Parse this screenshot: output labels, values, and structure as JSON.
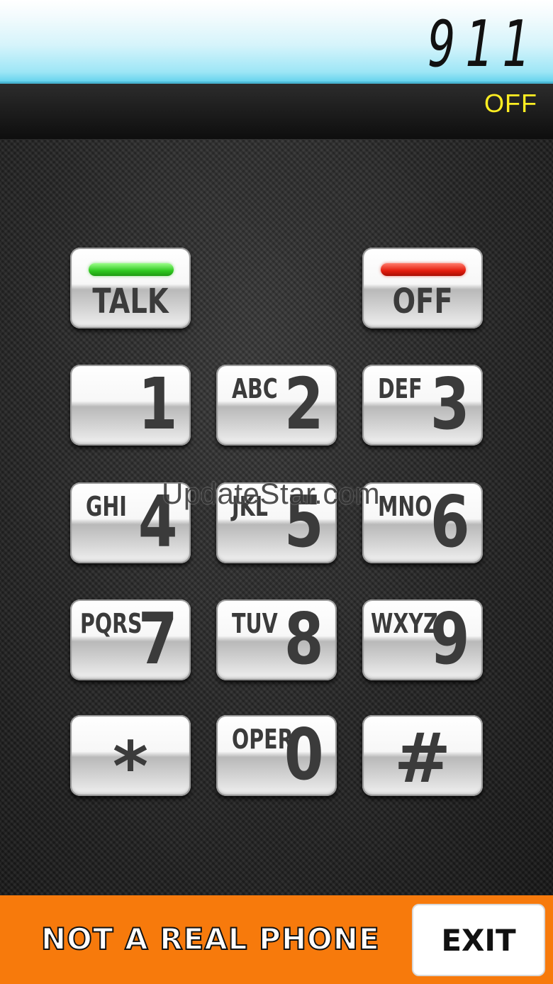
{
  "display": {
    "number": "911",
    "status": "OFF"
  },
  "keypad": {
    "talk": {
      "label": "TALK",
      "led_color": "#2fc81f"
    },
    "off": {
      "label": "OFF",
      "led_color": "#e31b0c"
    },
    "keys": [
      {
        "digit": "1",
        "letters": ""
      },
      {
        "digit": "2",
        "letters": "ABC"
      },
      {
        "digit": "3",
        "letters": "DEF"
      },
      {
        "digit": "4",
        "letters": "GHI"
      },
      {
        "digit": "5",
        "letters": "JKL"
      },
      {
        "digit": "6",
        "letters": "MNO"
      },
      {
        "digit": "7",
        "letters": "PQRS"
      },
      {
        "digit": "8",
        "letters": "TUV"
      },
      {
        "digit": "9",
        "letters": "WXYZ"
      },
      {
        "digit": "*",
        "letters": ""
      },
      {
        "digit": "0",
        "letters": "OPER"
      },
      {
        "digit": "#",
        "letters": ""
      }
    ]
  },
  "watermark": "UpdateStar.com",
  "footer": {
    "notice": "NOT A REAL PHONE",
    "exit_label": "EXIT",
    "background": "#f77a0c"
  }
}
